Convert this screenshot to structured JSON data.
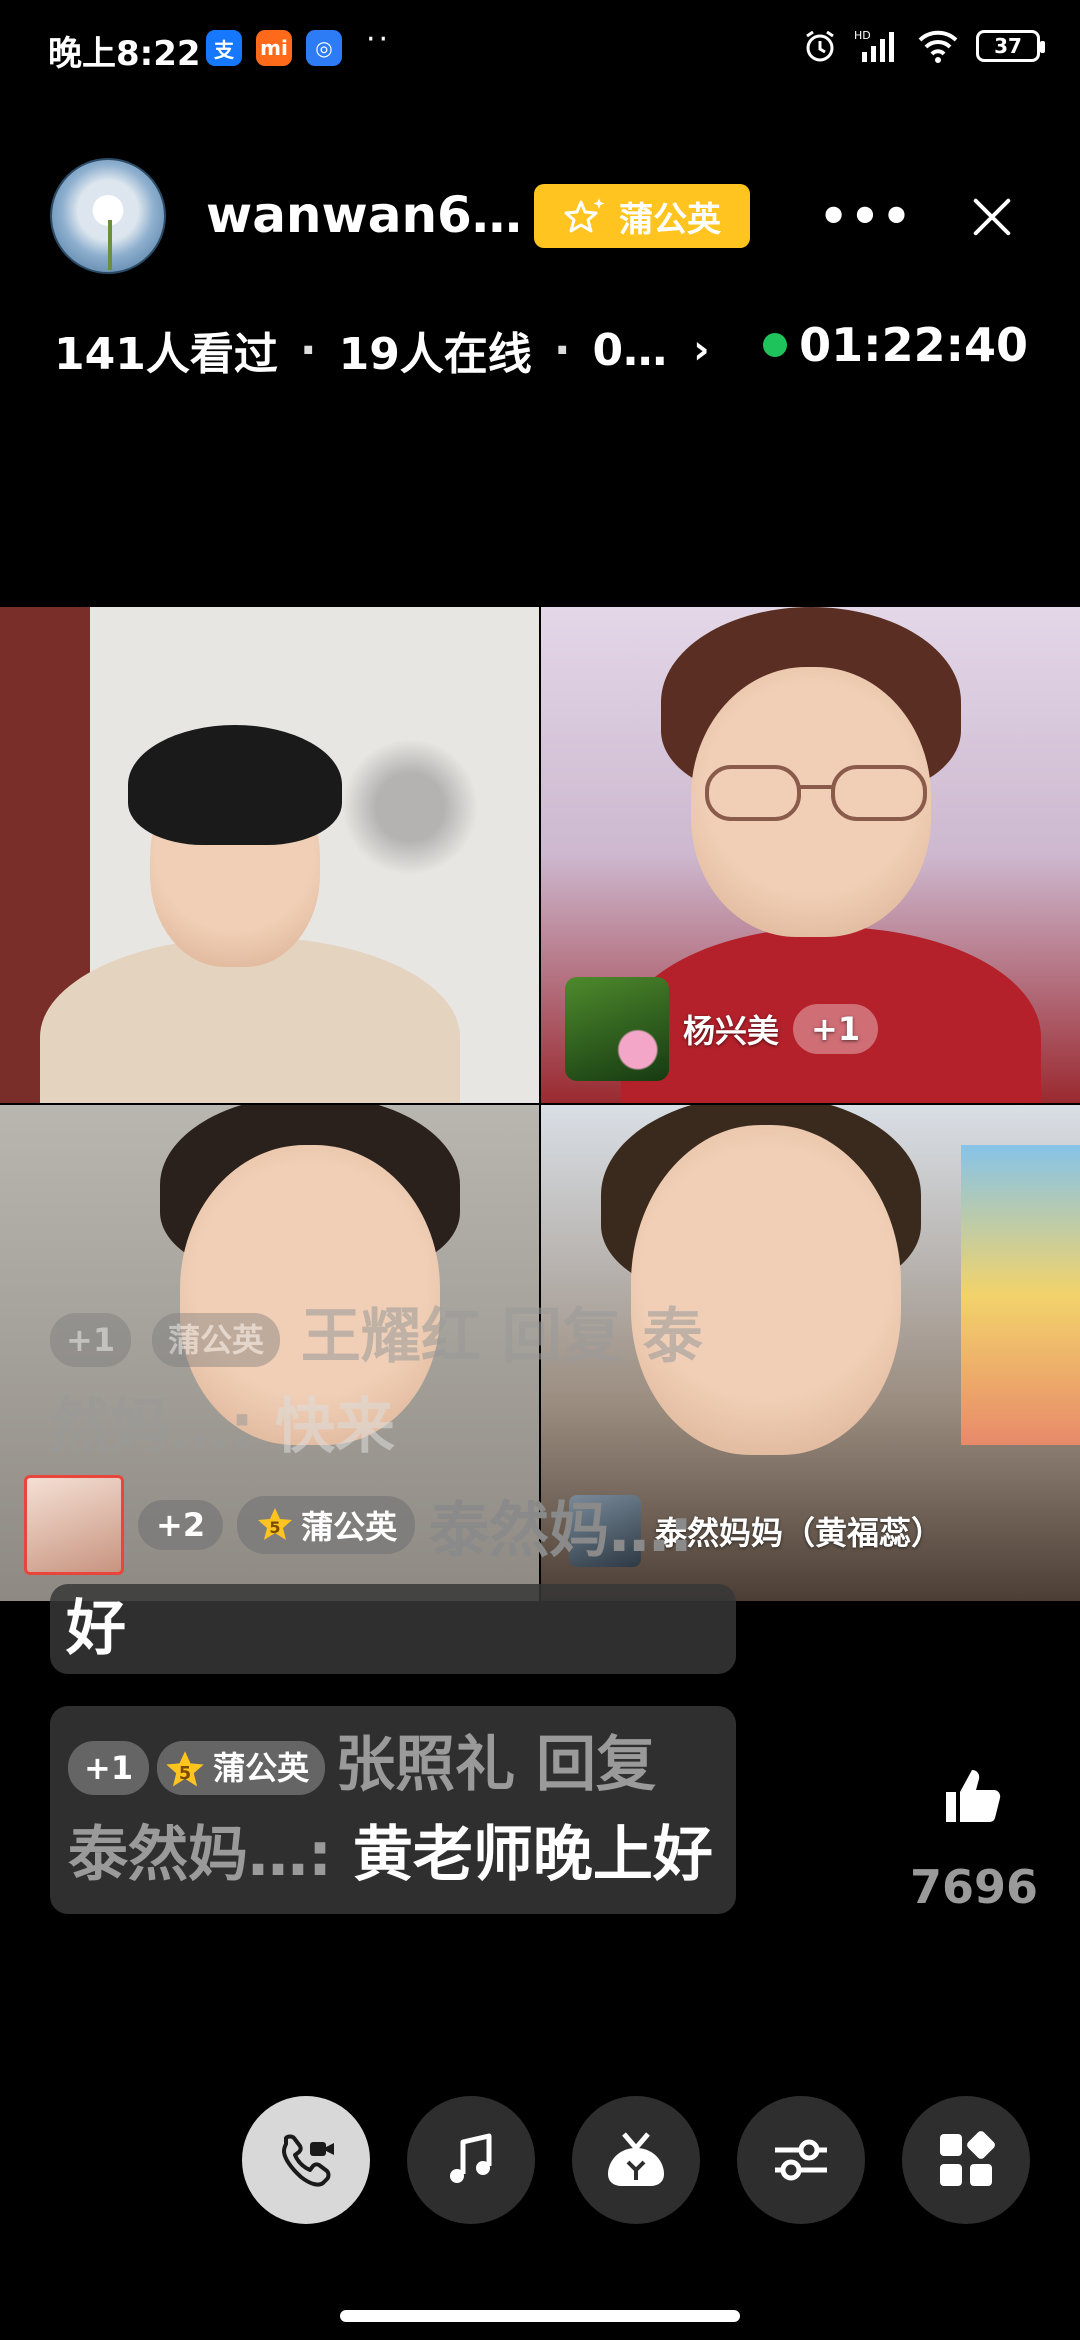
{
  "status_bar": {
    "time": "晚上8:22",
    "apps": [
      {
        "icon": "alipay-icon",
        "glyph": "支",
        "color": "#1677ff"
      },
      {
        "icon": "mi-store-icon",
        "glyph": "mi",
        "color": "#ff6a1a"
      },
      {
        "icon": "chat-bubble-app-icon",
        "glyph": "◎",
        "color": "#2d7cf6"
      }
    ],
    "more": "··",
    "signal_tag": "HD",
    "battery": "37"
  },
  "header": {
    "host_name": "wanwan6…",
    "badge_label": "蒲公英",
    "viewed": "141人看过",
    "online": "19人在线",
    "more_stat": "0…",
    "timer": "01:22:40"
  },
  "tiles": [
    {
      "name": ""
    },
    {
      "name": "杨兴美",
      "plus": "+1"
    },
    {
      "name": ""
    },
    {
      "name": "泰然妈妈（黄福蕊）"
    }
  ],
  "comments": [
    {
      "plus": "+1",
      "level": "",
      "badge": "蒲公英",
      "user": "王耀红 回复 泰然妈…:",
      "message": " 快来"
    },
    {
      "plus": "+2",
      "level": "5",
      "badge": "蒲公英",
      "user": "泰然妈…:",
      "message": "好"
    },
    {
      "plus": "+1",
      "level": "5",
      "badge": "蒲公英",
      "user": "张照礼 回复 泰然妈…:",
      "message": " 黄老师晚上好"
    }
  ],
  "likes": {
    "count": "7696"
  },
  "toolbar": [
    "voice-call-icon",
    "music-icon",
    "gift-bag-icon",
    "adjust-icon",
    "apps-grid-icon"
  ],
  "colors": {
    "accent_badge": "#ffc41f",
    "live_dot": "#1fc35b",
    "username_gray": "#9a9a9a"
  }
}
